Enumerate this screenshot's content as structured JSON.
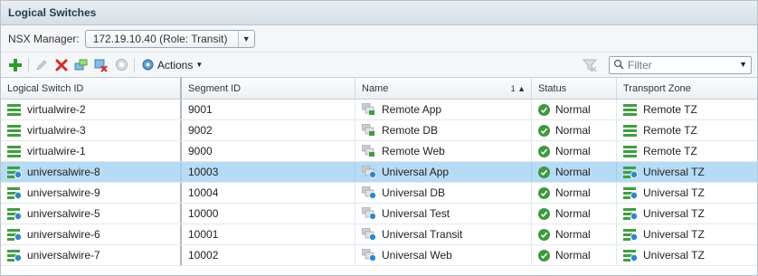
{
  "panel": {
    "title": "Logical Switches"
  },
  "manager": {
    "label": "NSX Manager:",
    "selected": "172.19.10.40 (Role: Transit)"
  },
  "toolbar": {
    "icons": [
      "add-icon",
      "edit-icon",
      "delete-icon",
      "move-icon",
      "remove-icon",
      "disabled-icon",
      "actions-gear-icon"
    ],
    "actions_label": "Actions",
    "filter_placeholder": "Filter"
  },
  "columns": [
    {
      "label": "Logical Switch ID"
    },
    {
      "label": "Segment ID"
    },
    {
      "label": "Name",
      "sort": "1 ▲"
    },
    {
      "label": "Status"
    },
    {
      "label": "Transport Zone"
    }
  ],
  "rows": [
    {
      "id": "virtualwire-2",
      "segment": "9001",
      "name": "Remote App",
      "status": "Normal",
      "zone": "Remote TZ",
      "kind": "local"
    },
    {
      "id": "virtualwire-3",
      "segment": "9002",
      "name": "Remote DB",
      "status": "Normal",
      "zone": "Remote TZ",
      "kind": "local"
    },
    {
      "id": "virtualwire-1",
      "segment": "9000",
      "name": "Remote Web",
      "status": "Normal",
      "zone": "Remote TZ",
      "kind": "local"
    },
    {
      "id": "universalwire-8",
      "segment": "10003",
      "name": "Universal App",
      "status": "Normal",
      "zone": "Universal TZ",
      "kind": "universal",
      "selected": true
    },
    {
      "id": "universalwire-9",
      "segment": "10004",
      "name": "Universal DB",
      "status": "Normal",
      "zone": "Universal TZ",
      "kind": "universal"
    },
    {
      "id": "universalwire-5",
      "segment": "10000",
      "name": "Universal Test",
      "status": "Normal",
      "zone": "Universal TZ",
      "kind": "universal"
    },
    {
      "id": "universalwire-6",
      "segment": "10001",
      "name": "Universal Transit",
      "status": "Normal",
      "zone": "Universal TZ",
      "kind": "universal"
    },
    {
      "id": "universalwire-7",
      "segment": "10002",
      "name": "Universal Web",
      "status": "Normal",
      "zone": "Universal TZ",
      "kind": "universal"
    }
  ],
  "colors": {
    "selected_row": "#b6dcf5",
    "status_ok": "#3c9a3c",
    "add_green": "#2e9a2e",
    "delete_red": "#d42b2b"
  }
}
